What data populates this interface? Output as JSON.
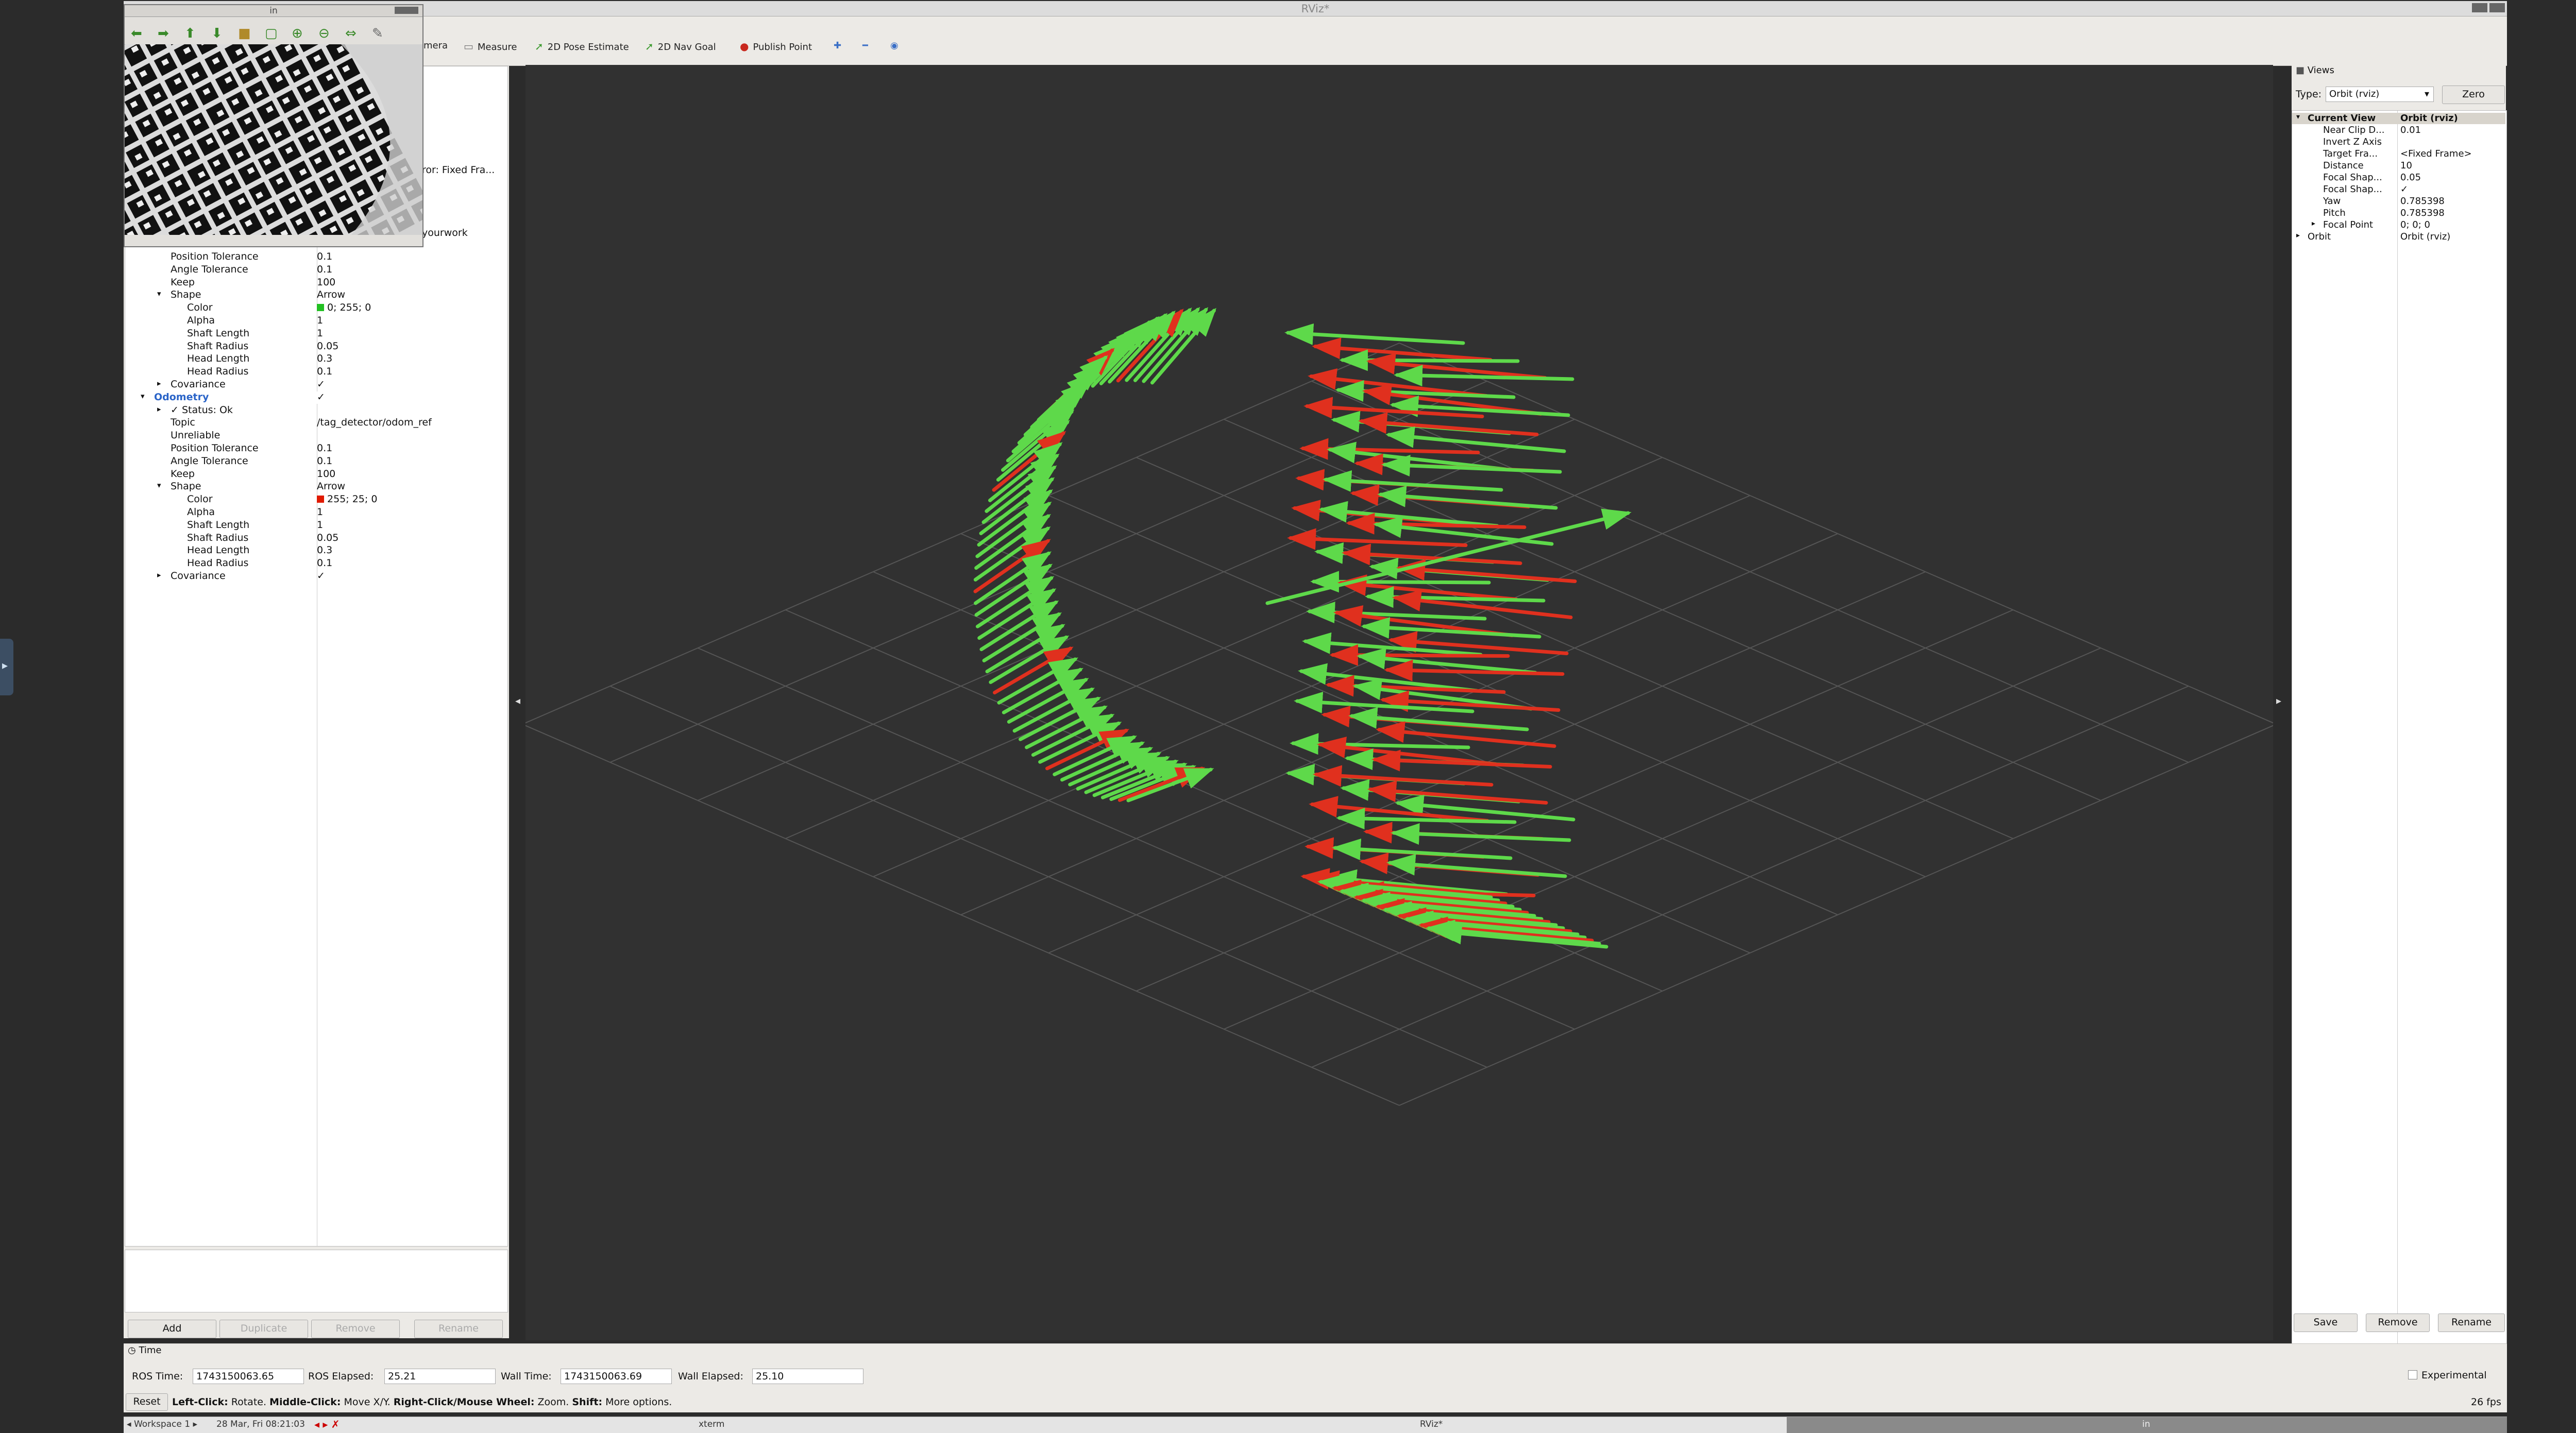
{
  "window": {
    "title": "RViz*"
  },
  "image_window": {
    "title": "in"
  },
  "toolbar": {
    "items": [
      {
        "label": "mera",
        "icon": "camera-icon"
      },
      {
        "label": "Measure",
        "icon": "ruler-icon"
      },
      {
        "label": "2D Pose Estimate",
        "icon": "pose-arrow-icon"
      },
      {
        "label": "2D Nav Goal",
        "icon": "goal-arrow-icon"
      },
      {
        "label": "Publish Point",
        "icon": "pin-icon"
      }
    ]
  },
  "displays": {
    "partial_texts": [
      "ror: Fixed Fra...",
      "yourwork"
    ],
    "rows": [
      {
        "indent": 1,
        "key": "Position Tolerance",
        "value": "0.1"
      },
      {
        "indent": 1,
        "key": "Angle Tolerance",
        "value": "0.1"
      },
      {
        "indent": 1,
        "key": "Keep",
        "value": "100"
      },
      {
        "indent": 1,
        "key": "Shape",
        "value": "Arrow",
        "expander": "open"
      },
      {
        "indent": 2,
        "key": "Color",
        "value": "0; 255; 0",
        "swatch": "#22c022"
      },
      {
        "indent": 2,
        "key": "Alpha",
        "value": "1"
      },
      {
        "indent": 2,
        "key": "Shaft Length",
        "value": "1"
      },
      {
        "indent": 2,
        "key": "Shaft Radius",
        "value": "0.05"
      },
      {
        "indent": 2,
        "key": "Head Length",
        "value": "0.3"
      },
      {
        "indent": 2,
        "key": "Head Radius",
        "value": "0.1"
      },
      {
        "indent": 1,
        "key": "Covariance",
        "value": "✓",
        "expander": "closed"
      },
      {
        "indent": 0,
        "key": "Odometry",
        "value": "✓",
        "expander": "open",
        "highlight": true
      },
      {
        "indent": 1,
        "key": "✓ Status: Ok",
        "value": "",
        "expander": "closed"
      },
      {
        "indent": 1,
        "key": "Topic",
        "value": "/tag_detector/odom_ref"
      },
      {
        "indent": 1,
        "key": "Unreliable",
        "value": ""
      },
      {
        "indent": 1,
        "key": "Position Tolerance",
        "value": "0.1"
      },
      {
        "indent": 1,
        "key": "Angle Tolerance",
        "value": "0.1"
      },
      {
        "indent": 1,
        "key": "Keep",
        "value": "100"
      },
      {
        "indent": 1,
        "key": "Shape",
        "value": "Arrow",
        "expander": "open"
      },
      {
        "indent": 2,
        "key": "Color",
        "value": "255; 25; 0",
        "swatch": "#e01a00"
      },
      {
        "indent": 2,
        "key": "Alpha",
        "value": "1"
      },
      {
        "indent": 2,
        "key": "Shaft Length",
        "value": "1"
      },
      {
        "indent": 2,
        "key": "Shaft Radius",
        "value": "0.05"
      },
      {
        "indent": 2,
        "key": "Head Length",
        "value": "0.3"
      },
      {
        "indent": 2,
        "key": "Head Radius",
        "value": "0.1"
      },
      {
        "indent": 1,
        "key": "Covariance",
        "value": "✓",
        "expander": "closed"
      }
    ],
    "buttons": {
      "add": "Add",
      "duplicate": "Duplicate",
      "remove": "Remove",
      "rename": "Rename"
    }
  },
  "views": {
    "title": "Views",
    "type_label": "Type:",
    "type_value": "Orbit (rviz)",
    "zero_label": "Zero",
    "rows": [
      {
        "indent": 0,
        "key": "Current View",
        "value": "Orbit (rviz)",
        "expander": "open",
        "header": true
      },
      {
        "indent": 1,
        "key": "Near Clip D...",
        "value": "0.01"
      },
      {
        "indent": 1,
        "key": "Invert Z Axis",
        "value": ""
      },
      {
        "indent": 1,
        "key": "Target Fra...",
        "value": "<Fixed Frame>"
      },
      {
        "indent": 1,
        "key": "Distance",
        "value": "10"
      },
      {
        "indent": 1,
        "key": "Focal Shap...",
        "value": "0.05"
      },
      {
        "indent": 1,
        "key": "Focal Shap...",
        "value": "✓"
      },
      {
        "indent": 1,
        "key": "Yaw",
        "value": "0.785398"
      },
      {
        "indent": 1,
        "key": "Pitch",
        "value": "0.785398"
      },
      {
        "indent": 1,
        "key": "Focal Point",
        "value": "0; 0; 0",
        "expander": "closed"
      },
      {
        "indent": 0,
        "key": "Orbit",
        "value": "Orbit (rviz)",
        "expander": "closed"
      }
    ],
    "buttons": {
      "save": "Save",
      "remove": "Remove",
      "rename": "Rename"
    }
  },
  "time_panel": {
    "title": "Time",
    "ros_time_label": "ROS Time:",
    "ros_time": "1743150063.65",
    "ros_elapsed_label": "ROS Elapsed:",
    "ros_elapsed": "25.21",
    "wall_time_label": "Wall Time:",
    "wall_time": "1743150063.69",
    "wall_elapsed_label": "Wall Elapsed:",
    "wall_elapsed": "25.10",
    "experimental_label": "Experimental"
  },
  "status_bar": {
    "reset": "Reset",
    "left_click": "Left-Click:",
    "left_click_text": "Rotate.",
    "middle_click": "Middle-Click:",
    "middle_click_text": "Move X/Y.",
    "right_click": "Right-Click/Mouse Wheel:",
    "right_click_text": "Zoom.",
    "shift": "Shift:",
    "shift_text": "More options.",
    "fps": "26 fps"
  },
  "taskbar": {
    "workspace": "Workspace 1",
    "datetime": "28 Mar, Fri 08:21:03",
    "task1": "xterm",
    "task2": "RViz*",
    "task3": "in"
  },
  "colors": {
    "green_arrow": "#5ed94a",
    "red_arrow": "#e0301e",
    "grid": "#555555",
    "background": "#313131"
  }
}
